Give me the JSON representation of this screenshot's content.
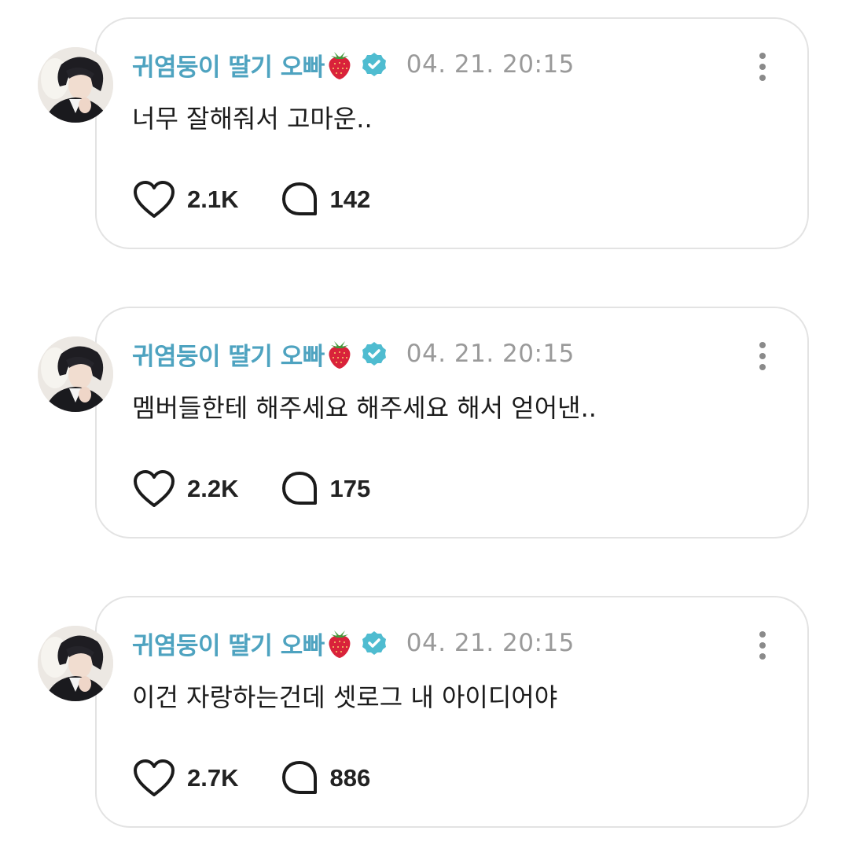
{
  "colors": {
    "author": "#4ea3c0",
    "timestamp": "#9a9a9a",
    "text": "#1b1b1b",
    "border": "#e3e3e3",
    "verified": "#4fbcd0",
    "strawberry": "#d9223a"
  },
  "icons": {
    "like": "heart-outline-icon",
    "reply": "speech-bubble-outline-icon",
    "more": "vertical-ellipsis-icon",
    "verified": "verified-badge-icon",
    "emoji": "strawberry-emoji"
  },
  "posts": [
    {
      "author": "귀염둥이 딸기 오빠",
      "timestamp": "04. 21. 20:15",
      "text": "너무 잘해줘서 고마운..",
      "likes": "2.1K",
      "replies": "142"
    },
    {
      "author": "귀염둥이 딸기 오빠",
      "timestamp": "04. 21. 20:15",
      "text": "멤버들한테 해주세요 해주세요 해서 얻어낸..",
      "likes": "2.2K",
      "replies": "175"
    },
    {
      "author": "귀염둥이 딸기 오빠",
      "timestamp": "04. 21. 20:15",
      "text": "이건 자랑하는건데 셋로그 내 아이디어야",
      "likes": "2.7K",
      "replies": "886"
    }
  ]
}
